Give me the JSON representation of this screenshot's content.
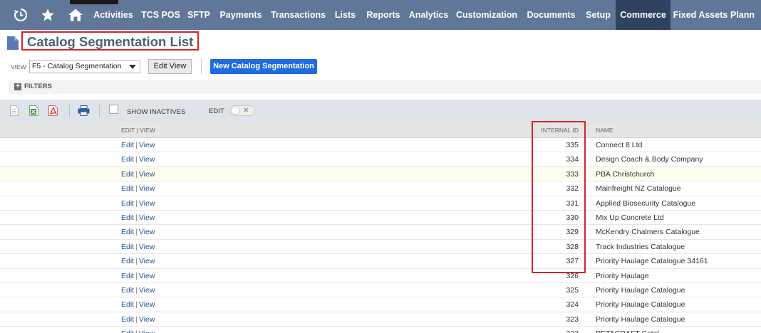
{
  "nav": {
    "items": [
      {
        "label": "Activities"
      },
      {
        "label": "TCS POS"
      },
      {
        "label": "SFTP"
      },
      {
        "label": "Payments"
      },
      {
        "label": "Transactions"
      },
      {
        "label": "Lists"
      },
      {
        "label": "Reports"
      },
      {
        "label": "Analytics"
      },
      {
        "label": "Customization"
      },
      {
        "label": "Documents"
      },
      {
        "label": "Setup"
      },
      {
        "label": "Commerce"
      },
      {
        "label": "Fixed Assets"
      },
      {
        "label": "Plann"
      }
    ],
    "active": "Commerce",
    "icons": [
      "recent-records-icon",
      "star-icon",
      "home-icon"
    ]
  },
  "page": {
    "title": "Catalog Segmentation List",
    "view_label": "VIEW",
    "view_value": "F5 - Catalog Segmentation",
    "edit_view_label": "Edit View",
    "new_label": "New Catalog Segmentation",
    "filters_label": "FILTERS"
  },
  "toolbar": {
    "show_inactives_label": "SHOW INACTIVES",
    "edit_label": "EDIT",
    "icons": [
      "export-csv-icon",
      "export-excel-icon",
      "export-pdf-icon",
      "print-icon"
    ]
  },
  "table": {
    "headers": {
      "edit_view": "EDIT | VIEW",
      "internal_id": "INTERNAL ID",
      "name": "NAME"
    },
    "link_edit": "Edit",
    "link_view": "View",
    "rows": [
      {
        "id": "335",
        "name": "Connect 8 Ltd"
      },
      {
        "id": "334",
        "name": "Design Coach & Body Company"
      },
      {
        "id": "333",
        "name": "PBA Christchurch"
      },
      {
        "id": "332",
        "name": "Mainfreight NZ Catalogue"
      },
      {
        "id": "331",
        "name": "Applied Biosecurity Catalogue"
      },
      {
        "id": "330",
        "name": "Mix Up Concrete Ltd"
      },
      {
        "id": "329",
        "name": "McKendry Chalmers Catalogue"
      },
      {
        "id": "328",
        "name": "Track Industries Catalogue"
      },
      {
        "id": "327",
        "name": "Priority Haulage Catalogue 34161"
      },
      {
        "id": "326",
        "name": "Priority Haulage"
      },
      {
        "id": "325",
        "name": "Priority Haulage Catalogue"
      },
      {
        "id": "324",
        "name": "Priority Haulage Catalogue"
      },
      {
        "id": "323",
        "name": "Priority Haulage Catalogue"
      },
      {
        "id": "322",
        "name": "PETACRAFT Catal"
      }
    ]
  },
  "colors": {
    "nav_bg": "#607799",
    "nav_active_bg": "#2f4360",
    "highlight_box": "#d8222a",
    "primary_button": "#1f6be0",
    "link": "#24558f"
  }
}
